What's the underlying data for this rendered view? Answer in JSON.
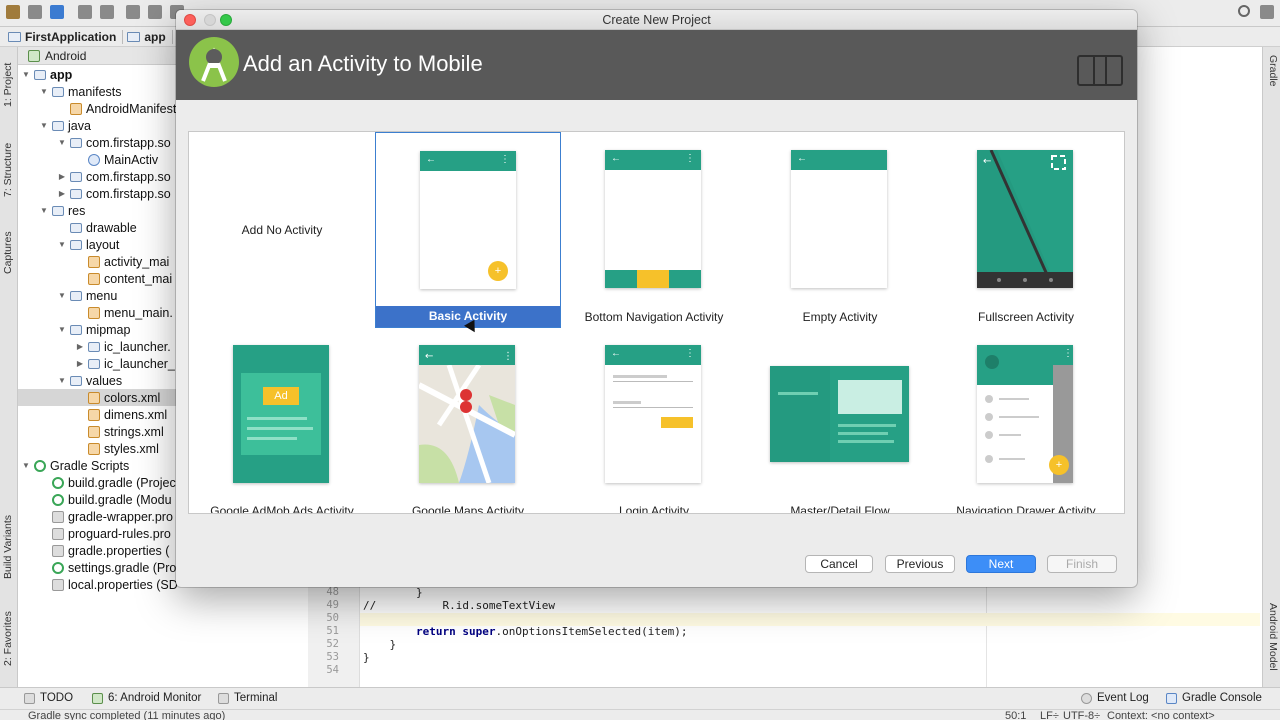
{
  "colors": {
    "accent": "#3c72c9",
    "teal": "#26a085",
    "header_bg": "#595959",
    "android_green": "#8bc34a",
    "fab_yellow": "#f6c12a"
  },
  "breadcrumb": [
    "FirstApplication",
    "app"
  ],
  "left_tabs": [
    "1: Project",
    "7: Structure",
    "Captures",
    "Build Variants",
    "2: Favorites"
  ],
  "right_tabs": [
    "Gradle",
    "Android Model"
  ],
  "project": {
    "view_label": "Android",
    "tree": [
      {
        "label": "app",
        "icon": "folder"
      },
      {
        "label": "manifests",
        "icon": "folder"
      },
      {
        "label": "AndroidManifest.xml",
        "icon": "manifest"
      },
      {
        "label": "java",
        "icon": "folder"
      },
      {
        "label": "com.firstapp.so",
        "icon": "folder"
      },
      {
        "label": "MainActiv",
        "icon": "class"
      },
      {
        "label": "com.firstapp.so",
        "icon": "folder"
      },
      {
        "label": "com.firstapp.so",
        "icon": "folder"
      },
      {
        "label": "res",
        "icon": "folder"
      },
      {
        "label": "drawable",
        "icon": "folder"
      },
      {
        "label": "layout",
        "icon": "folder"
      },
      {
        "label": "activity_mai",
        "icon": "xml"
      },
      {
        "label": "content_mai",
        "icon": "xml"
      },
      {
        "label": "menu",
        "icon": "folder"
      },
      {
        "label": "menu_main.",
        "icon": "xml"
      },
      {
        "label": "mipmap",
        "icon": "folder"
      },
      {
        "label": "ic_launcher.",
        "icon": "folder"
      },
      {
        "label": "ic_launcher_",
        "icon": "folder"
      },
      {
        "label": "values",
        "icon": "folder"
      },
      {
        "label": "colors.xml",
        "icon": "xml"
      },
      {
        "label": "dimens.xml",
        "icon": "xml"
      },
      {
        "label": "strings.xml",
        "icon": "xml"
      },
      {
        "label": "styles.xml",
        "icon": "xml"
      },
      {
        "label": "Gradle Scripts",
        "icon": "gradle"
      },
      {
        "label": "build.gradle (Projec",
        "icon": "gradle"
      },
      {
        "label": "build.gradle (Modu",
        "icon": "gradle"
      },
      {
        "label": "gradle-wrapper.pro",
        "icon": "props"
      },
      {
        "label": "proguard-rules.pro",
        "icon": "props"
      },
      {
        "label": "gradle.properties (",
        "icon": "props"
      },
      {
        "label": "settings.gradle (Pro",
        "icon": "gradle"
      },
      {
        "label": "local.properties (SD",
        "icon": "props"
      }
    ]
  },
  "editor": {
    "lines": [
      {
        "num": "48",
        "text": "        }"
      },
      {
        "num": "49",
        "text": "//          R.id.someTextView"
      },
      {
        "num": "50",
        "text": ""
      },
      {
        "num": "51",
        "text": "        return super.onOptionsItemSelected(item);"
      },
      {
        "num": "52",
        "text": "    }"
      },
      {
        "num": "53",
        "text": "}"
      },
      {
        "num": "54",
        "text": ""
      }
    ]
  },
  "bottom_tools": [
    "TODO",
    "6: Android Monitor",
    "Terminal",
    "Event Log",
    "Gradle Console"
  ],
  "status": {
    "message": "Gradle sync completed (11 minutes ago)",
    "position": "50:1",
    "line_sep": "LF÷",
    "encoding": "UTF-8÷",
    "context": "Context: <no context>"
  },
  "dialog": {
    "window_title": "Create New Project",
    "header_title": "Add an Activity to Mobile",
    "activities": [
      {
        "label": "Add No Activity"
      },
      {
        "label": "Basic Activity",
        "selected": true
      },
      {
        "label": "Bottom Navigation Activity"
      },
      {
        "label": "Empty Activity"
      },
      {
        "label": "Fullscreen Activity"
      },
      {
        "label": "Google AdMob Ads Activity"
      },
      {
        "label": "Google Maps Activity"
      },
      {
        "label": "Login Activity"
      },
      {
        "label": "Master/Detail Flow"
      },
      {
        "label": "Navigation Drawer Activity"
      }
    ],
    "ad_badge": "Ad",
    "buttons": {
      "cancel": "Cancel",
      "previous": "Previous",
      "next": "Next",
      "finish": "Finish"
    }
  }
}
